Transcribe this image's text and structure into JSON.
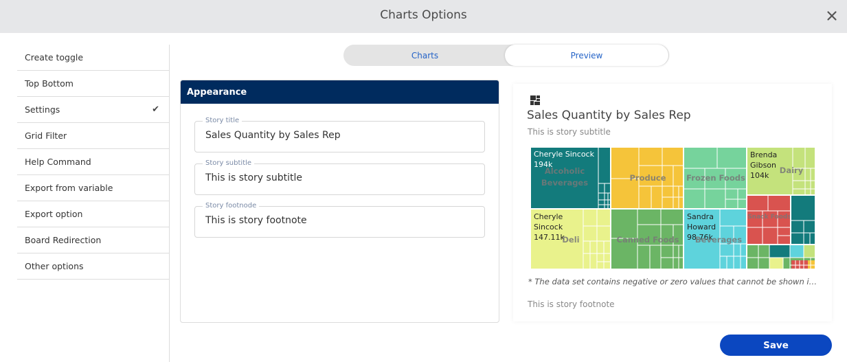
{
  "window": {
    "title": "Charts Options",
    "close_icon": "close-icon"
  },
  "sidebar": {
    "items": [
      {
        "label": "Create toggle",
        "checked": false
      },
      {
        "label": "Top Bottom",
        "checked": false
      },
      {
        "label": "Settings",
        "checked": true
      },
      {
        "label": "Grid Filter",
        "checked": false
      },
      {
        "label": "Help Command",
        "checked": false
      },
      {
        "label": "Export from variable",
        "checked": false
      },
      {
        "label": "Export option",
        "checked": false
      },
      {
        "label": "Board Redirection",
        "checked": false
      },
      {
        "label": "Other options",
        "checked": false
      }
    ],
    "check_icon": "✔"
  },
  "tabs": {
    "charts": "Charts",
    "preview": "Preview",
    "active": "Preview"
  },
  "appearance": {
    "header": "Appearance",
    "fields": {
      "title": {
        "label": "Story title",
        "value": "Sales Quantity by Sales Rep"
      },
      "subtitle": {
        "label": "Story subtitle",
        "value": "This is story subtitle"
      },
      "footnote": {
        "label": "Story footnode",
        "value": "This is story footnote"
      }
    }
  },
  "preview": {
    "icon": "treemap-icon",
    "title": "Sales Quantity by Sales Rep",
    "subtitle": "This is story subtitle",
    "note": "* The data set contains negative or zero values that cannot be shown in this chart.",
    "footnote": "This is story footnote",
    "treemap": {
      "categories": {
        "alcoholic": "Alcoholic Beverages",
        "produce": "Produce",
        "frozen": "Frozen Foods",
        "dairy": "Dairy",
        "deli": "Deli",
        "canned": "Canned Foods",
        "beverages": "Beverages",
        "snack": "Snack Foods"
      },
      "values": {
        "alcoholic": "Cheryle Sincock\n194k",
        "dairy": "Brenda\nGibson\n104k",
        "deli": "Cheryle\nSincock\n147.11k",
        "beverages": "Sandra\nHoward\n98.76k"
      },
      "colors": {
        "teal": "#137b7c",
        "yellow": "#f5c43a",
        "green_light": "#76d39c",
        "lime": "#c4e27c",
        "pale": "#e9f28c",
        "green": "#6bb565",
        "cyan": "#5ed3dc",
        "red": "#d9534f"
      }
    }
  },
  "actions": {
    "save": "Save"
  }
}
